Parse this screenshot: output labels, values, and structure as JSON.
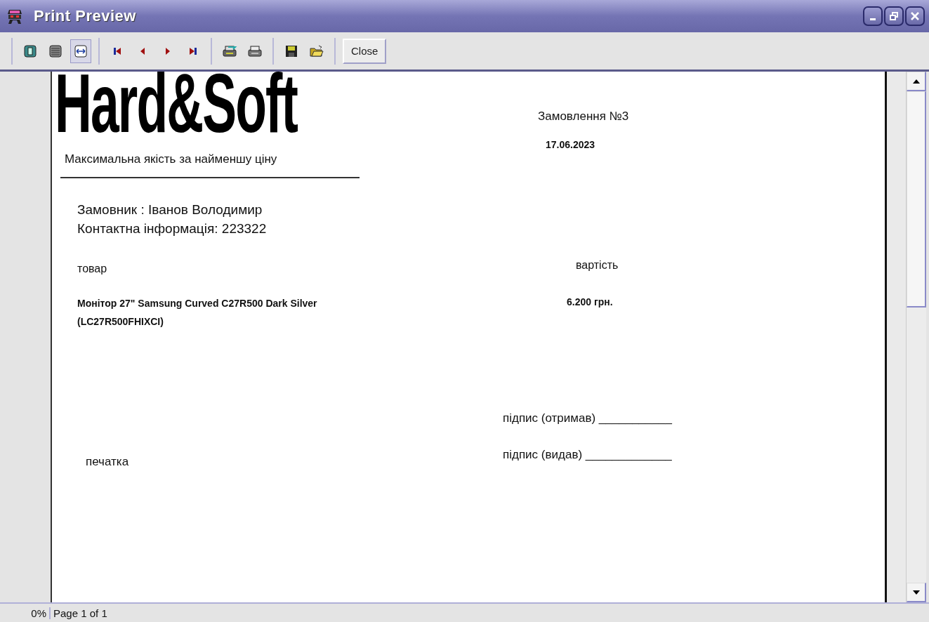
{
  "window": {
    "title": "Print Preview"
  },
  "toolbar": {
    "view_buttons": [
      {
        "kind": "one-page",
        "selected": false
      },
      {
        "kind": "page-width",
        "selected": false
      },
      {
        "kind": "fit",
        "selected": true
      }
    ],
    "close_button": "Close"
  },
  "report": {
    "logo": "Hard&Soft",
    "slogan": "Максимальна якість за найменшу ціну",
    "order_title": "Замовлення №3",
    "date": "17.06.2023",
    "customer": "Замовник : Іванов Володимир",
    "contact": "Контактна інформація: 223322",
    "product_header": "товар",
    "price_header": "вартість",
    "product_lines": [
      "Монітор 27\" Samsung Curved C27R500 Dark Silver",
      "(LC27R500FHIXCI)"
    ],
    "price": "6.200 грн.",
    "signature_received": "підпис (отримав) ___________",
    "signature_issued": "підпис (видав) _____________",
    "stamp": "печатка"
  },
  "status_bar": {
    "zoom": "0%",
    "page": "Page 1 of 1"
  }
}
